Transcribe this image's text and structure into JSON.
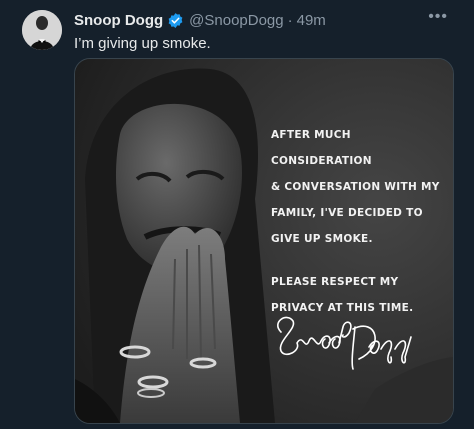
{
  "tweet": {
    "author_name": "Snoop Dogg",
    "handle": "@SnoopDogg",
    "separator": "·",
    "time": "49m",
    "text": "I’m giving up smoke.",
    "more_label": "•••"
  },
  "image": {
    "statement_line1": "After much consideration",
    "statement_line2": "& conversation with my",
    "statement_line3": "family, I've decided to",
    "statement_line4": "give up smoke.",
    "statement_line5": "Please respect my",
    "statement_line6": "privacy at this time.",
    "signature": "Snoop Dogg"
  },
  "colors": {
    "background": "#15202b",
    "verified_badge": "#1d9bf0",
    "secondary_text": "#8b98a5",
    "primary_text": "#e7e9ea"
  },
  "icons": {
    "verified": "verified-badge-icon",
    "more": "more-horizontal-icon"
  }
}
